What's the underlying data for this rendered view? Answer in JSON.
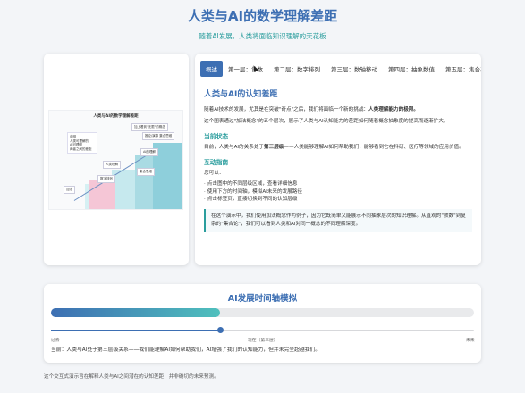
{
  "header": {
    "title": "人类与AI的数学理解差距",
    "subtitle": "随着AI发展，人类将面临知识理解的天花板"
  },
  "diagram": {
    "title": "人类与AI的数学理解差距",
    "legend_title": "说明",
    "legend_items": [
      "人类可理解的",
      "AI可理解",
      "两者之间的差距"
    ],
    "labels": [
      "加上看到\"无限\"的概念",
      "推论/演算 集合思维",
      "AI的理解",
      "人类理解",
      "集合思维",
      "数字排列",
      "加法"
    ],
    "colors": {
      "step_light": "#d6f0f3",
      "step_dark": "#8ecfdb",
      "gap": "#f5c6d6",
      "arrow": "#6b8fc2"
    }
  },
  "tabs": [
    {
      "label": "概述",
      "active": true
    },
    {
      "label": "第一层：计数",
      "active": false
    },
    {
      "label": "第二层：数字排列",
      "active": false
    },
    {
      "label": "第三层：数轴移动",
      "active": false
    },
    {
      "label": "第四层：抽象数值",
      "active": false
    },
    {
      "label": "第五层：集合基数",
      "active": false
    }
  ],
  "content": {
    "heading": "人类与AI的认知差距",
    "intro_before": "随着AI技术的发展，尤其是在突破\"奇点\"之后，我们将面临一个新的挑战：",
    "intro_bold": "人类理解能力的极限。",
    "intro2": "这个图表通过\"加法概念\"的五个层次，展示了人类与AI认知能力的差距如何随着概念抽象度的提高而逐渐扩大。",
    "status_heading": "当前状态",
    "status_before": "目前，人类与AI的关系处于",
    "status_bold": "第三层级",
    "status_after": "——人类能够理解AI如何帮助我们，能够看到它在科研、医疗等领域的应用价值。",
    "guide_heading": "互动指南",
    "guide_intro": "您可以：",
    "guide_items": [
      "点击图中的不同层级区域，查看详细信息",
      "使用下方的时间轴，模拟AI未来的发展路径",
      "点击标签页，直接切换到不同的认知层级"
    ],
    "note": "在这个演示中，我们使用加法概念作为例子，因为它既简单又能展示不同抽象层次的知识理解。从直观的\"数数\"到复杂的\"集合论\"，我们可以看到人类和AI对同一概念的不同理解深度。"
  },
  "timeline": {
    "title": "AI发展时间轴模拟",
    "progress": 0.4,
    "slider_value": 0.4,
    "tick_past": "过去",
    "tick_now": "现在（第三层）",
    "tick_future": "未来",
    "status": "当前：人类与AI处于第三层级关系——我们能理解AI如何帮助我们，AI增强了我们的认知能力，但并未完全超越我们。"
  },
  "footer": "这个交互式演示旨在解释人类与AI之间潜在的认知差距，并非确切的未来预测。"
}
